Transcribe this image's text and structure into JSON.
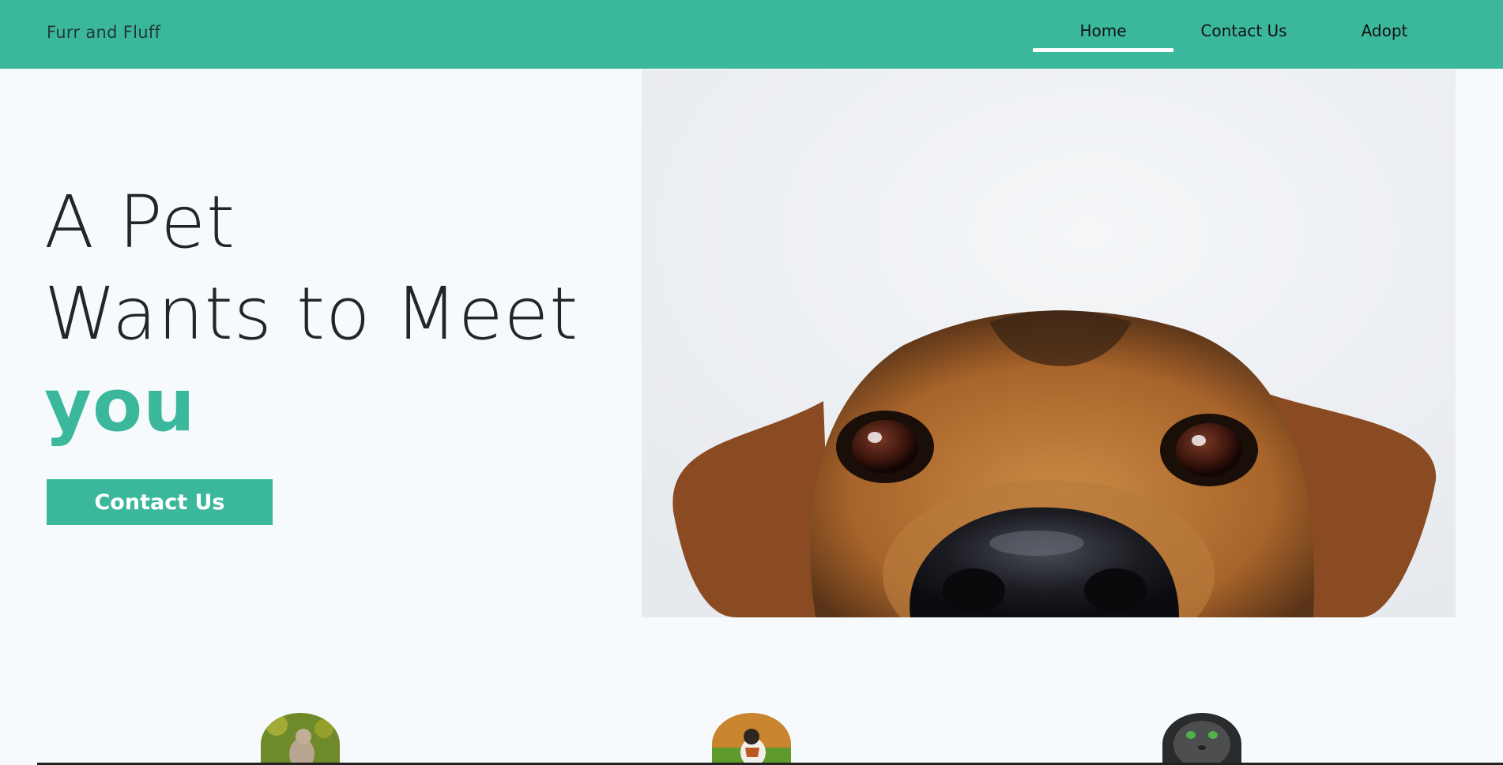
{
  "header": {
    "brand": "Furr and Fluff",
    "nav": [
      {
        "label": "Home",
        "active": true
      },
      {
        "label": "Contact Us",
        "active": false
      },
      {
        "label": "Adopt",
        "active": false
      }
    ],
    "background_color": "#3bb89c"
  },
  "hero": {
    "line1": "A Pet",
    "line2": "Wants to Meet",
    "line3": "you",
    "accent_color": "#3bb89c",
    "cta_label": "Contact Us",
    "image": "dog-peeking-photo"
  },
  "pets": [
    {
      "image": "cat-on-grass-photo"
    },
    {
      "image": "calico-cat-on-grass-photo"
    },
    {
      "image": "green-eyed-tabby-cat-photo"
    }
  ]
}
